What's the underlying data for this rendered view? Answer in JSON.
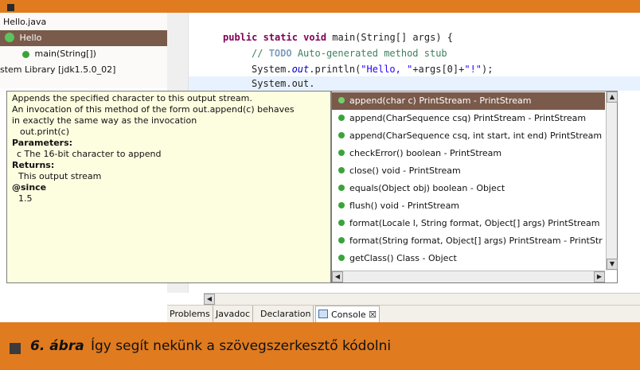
{
  "explorer": {
    "items": [
      {
        "label": "Hello.java"
      },
      {
        "label": "Hello"
      },
      {
        "label": "main(String[])"
      },
      {
        "label": "stem Library [jdk1.5.0_02]"
      }
    ]
  },
  "editor": {
    "lines": [
      {
        "text_keyword": "public static void",
        "text_rest": " main(String[] args) {"
      },
      {
        "comment_prefix": "// ",
        "todo": "TODO",
        "comment_rest": " Auto-generated method stub"
      },
      {
        "pre": "System.",
        "ital": "out",
        "mid": ".println(",
        "str1": "\"Hello, \"",
        "mid2": "+args[0]+",
        "str2": "\"!\"",
        "end": ");"
      },
      {
        "text": "System.out."
      }
    ]
  },
  "javadoc": {
    "lines": [
      "Appends the specified character to this output stream.",
      "An invocation of this method of the form out.append(c) behaves",
      " in exactly the same way as the invocation",
      "  out.print(c)",
      "Parameters:",
      "  c The 16-bit character to append",
      "Returns:",
      "  This output stream",
      "@since",
      "  1.5"
    ]
  },
  "assist": {
    "items": [
      "append(char c) PrintStream - PrintStream",
      "append(CharSequence csq) PrintStream - PrintStream",
      "append(CharSequence csq, int start, int end) PrintStream",
      "checkError() boolean - PrintStream",
      "close() void - PrintStream",
      "equals(Object obj) boolean - Object",
      "flush() void - PrintStream",
      "format(Locale l, String format, Object[] args) PrintStream",
      "format(String format, Object[] args) PrintStream - PrintStr",
      "getClass() Class - Object"
    ]
  },
  "tabs": [
    "Problems",
    "Javadoc",
    "Declaration",
    "Console ☒"
  ],
  "caption": {
    "label": "6. ábra",
    "text": "Így segít nekünk a szövegszerkesztő kódolni"
  }
}
